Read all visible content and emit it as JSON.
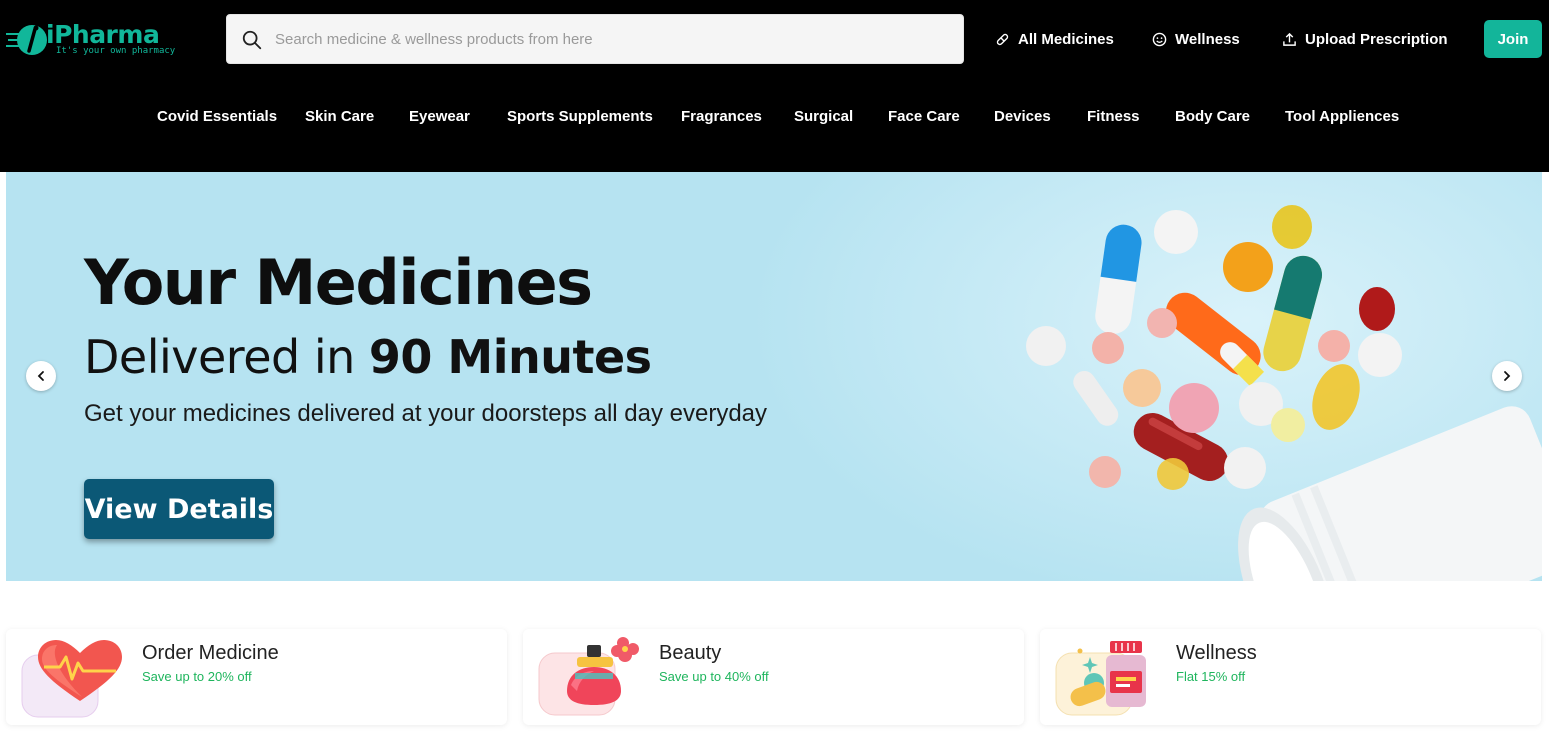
{
  "brand": {
    "name": "iPharma",
    "tagline": "It's your own pharmacy",
    "accent_color": "#13b59a"
  },
  "search": {
    "placeholder": "Search medicine & wellness products from here",
    "value": ""
  },
  "top_nav": {
    "items": [
      {
        "label": "All Medicines",
        "icon": "pill-icon"
      },
      {
        "label": "Wellness",
        "icon": "smile-icon"
      },
      {
        "label": "Upload Prescription",
        "icon": "upload-icon"
      }
    ],
    "join_label": "Join"
  },
  "categories": [
    "Covid Essentials",
    "Skin Care",
    "Eyewear",
    "Sports Supplements",
    "Fragrances",
    "Surgical",
    "Face Care",
    "Devices",
    "Fitness",
    "Body Care",
    "Tool Appliences"
  ],
  "banner": {
    "title": "Your Medicines",
    "subtitle_prefix": "Delivered in",
    "subtitle_bold": "90 Minutes",
    "description": "Get your medicines delivered at your doorsteps all day everyday",
    "button_label": "View Details",
    "bg_color": "#b6e3f1"
  },
  "cards": [
    {
      "title": "Order Medicine",
      "subtitle": "Save up to 20% off",
      "icon": "heart-pulse-icon"
    },
    {
      "title": "Beauty",
      "subtitle": "Save up to 40% off",
      "icon": "perfume-icon"
    },
    {
      "title": "Wellness",
      "subtitle": "Flat 15% off",
      "icon": "supplements-icon"
    }
  ]
}
